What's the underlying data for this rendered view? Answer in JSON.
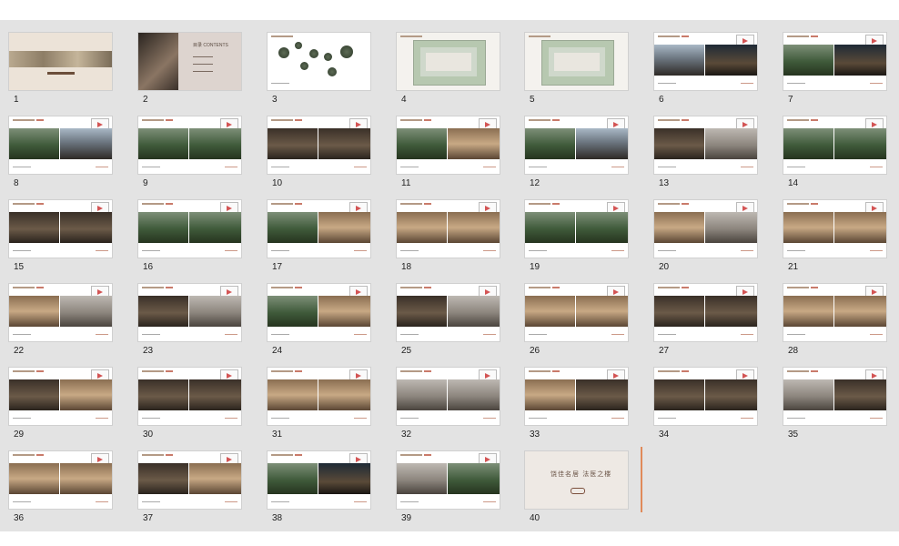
{
  "sorter": {
    "accent_color": "#e08a5a",
    "slides": [
      {
        "num": "1",
        "kind": "cover"
      },
      {
        "num": "2",
        "kind": "toc",
        "title": "目录 CONTENTS",
        "items": [
          "一、",
          "二、",
          "三、"
        ]
      },
      {
        "num": "3",
        "kind": "circles"
      },
      {
        "num": "4",
        "kind": "siteplan"
      },
      {
        "num": "5",
        "kind": "siteplan"
      },
      {
        "num": "6",
        "kind": "photos",
        "photos": [
          "sky",
          "night"
        ]
      },
      {
        "num": "7",
        "kind": "photos",
        "photos": [
          "green",
          "night"
        ]
      },
      {
        "num": "8",
        "kind": "photos",
        "photos": [
          "green",
          "sky"
        ]
      },
      {
        "num": "9",
        "kind": "photos",
        "photos": [
          "green",
          "green"
        ]
      },
      {
        "num": "10",
        "kind": "photos",
        "photos": [
          "dark",
          "dark"
        ]
      },
      {
        "num": "11",
        "kind": "photos",
        "photos": [
          "green",
          "warm"
        ]
      },
      {
        "num": "12",
        "kind": "photos",
        "photos": [
          "green",
          "sky"
        ]
      },
      {
        "num": "13",
        "kind": "photos",
        "photos": [
          "dark",
          "grey"
        ]
      },
      {
        "num": "14",
        "kind": "photos",
        "photos": [
          "green",
          "green"
        ]
      },
      {
        "num": "15",
        "kind": "photos",
        "photos": [
          "dark",
          "dark"
        ]
      },
      {
        "num": "16",
        "kind": "photos",
        "photos": [
          "green",
          "green"
        ]
      },
      {
        "num": "17",
        "kind": "photos",
        "photos": [
          "green",
          "warm"
        ]
      },
      {
        "num": "18",
        "kind": "photos",
        "photos": [
          "warm",
          "warm"
        ]
      },
      {
        "num": "19",
        "kind": "photos",
        "photos": [
          "green",
          "green"
        ]
      },
      {
        "num": "20",
        "kind": "photos",
        "photos": [
          "warm",
          "grey"
        ]
      },
      {
        "num": "21",
        "kind": "photos",
        "photos": [
          "warm",
          "warm"
        ]
      },
      {
        "num": "22",
        "kind": "photos",
        "photos": [
          "warm",
          "grey"
        ]
      },
      {
        "num": "23",
        "kind": "photos",
        "photos": [
          "dark",
          "grey"
        ]
      },
      {
        "num": "24",
        "kind": "photos",
        "photos": [
          "green",
          "warm"
        ]
      },
      {
        "num": "25",
        "kind": "photos",
        "photos": [
          "dark",
          "grey"
        ]
      },
      {
        "num": "26",
        "kind": "photos",
        "photos": [
          "warm",
          "warm"
        ]
      },
      {
        "num": "27",
        "kind": "photos",
        "photos": [
          "dark",
          "dark"
        ]
      },
      {
        "num": "28",
        "kind": "photos",
        "photos": [
          "warm",
          "warm"
        ]
      },
      {
        "num": "29",
        "kind": "photos",
        "photos": [
          "dark",
          "warm"
        ]
      },
      {
        "num": "30",
        "kind": "photos",
        "photos": [
          "dark",
          "dark"
        ]
      },
      {
        "num": "31",
        "kind": "photos",
        "photos": [
          "warm",
          "warm"
        ]
      },
      {
        "num": "32",
        "kind": "photos",
        "photos": [
          "grey",
          "grey"
        ]
      },
      {
        "num": "33",
        "kind": "photos",
        "photos": [
          "warm",
          "dark"
        ]
      },
      {
        "num": "34",
        "kind": "photos",
        "photos": [
          "dark",
          "dark"
        ]
      },
      {
        "num": "35",
        "kind": "photos",
        "photos": [
          "grey",
          "dark"
        ]
      },
      {
        "num": "36",
        "kind": "photos",
        "photos": [
          "warm",
          "warm"
        ]
      },
      {
        "num": "37",
        "kind": "photos",
        "photos": [
          "dark",
          "warm"
        ]
      },
      {
        "num": "38",
        "kind": "photos",
        "photos": [
          "green",
          "night"
        ]
      },
      {
        "num": "39",
        "kind": "photos",
        "photos": [
          "grey",
          "green"
        ]
      },
      {
        "num": "40",
        "kind": "ending",
        "text": "饶佳名居  法医之楼"
      }
    ]
  }
}
